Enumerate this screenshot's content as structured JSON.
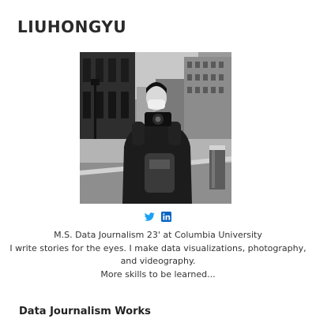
{
  "site": {
    "title": "LIUHONGYU"
  },
  "profile": {
    "photo_icon": "portrait-photo",
    "social": [
      {
        "icon": "twitter-icon",
        "color": "#1da1f2"
      },
      {
        "icon": "linkedin-icon",
        "color": "#0a66c2"
      }
    ]
  },
  "bio": {
    "line1": "M.S. Data Journalism 23' at Columbia University",
    "line2": "I write stories for the eyes. I make data visualizations, photography, and videography.",
    "line3": "More skills to be learned..."
  },
  "sections": {
    "works_heading": "Data Journalism Works"
  }
}
